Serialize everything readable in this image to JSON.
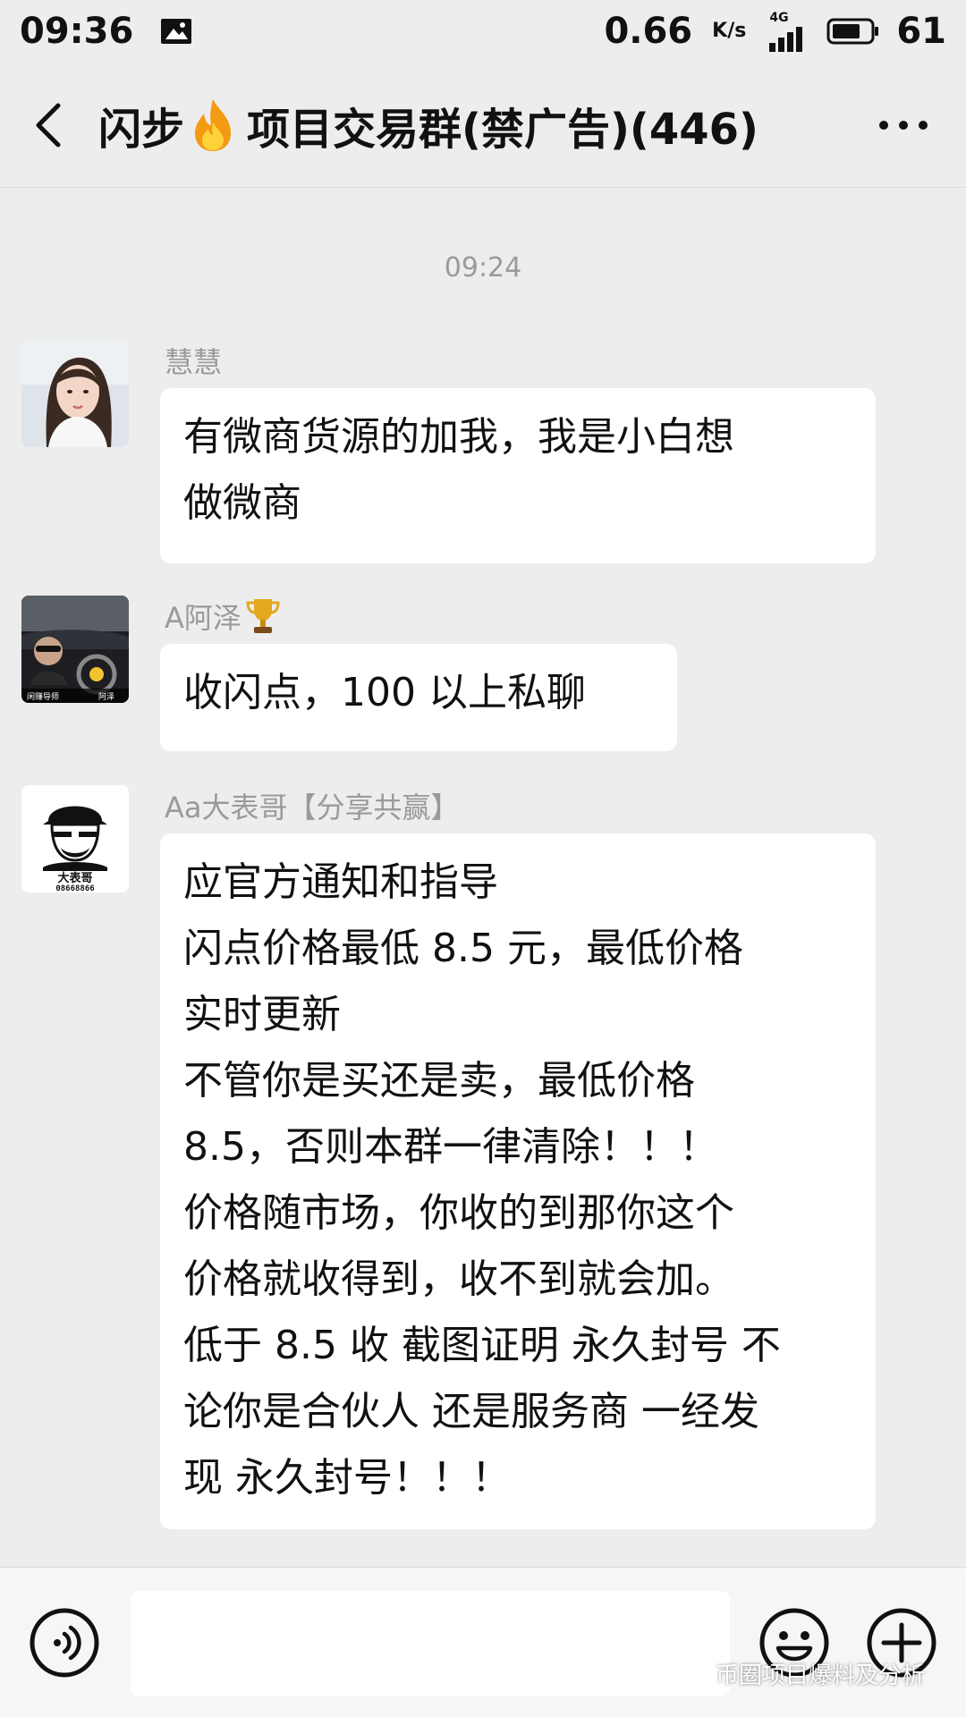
{
  "status_bar": {
    "time": "09:36",
    "net_speed": "0.66",
    "net_unit": "K/s",
    "network_type": "4G",
    "battery": "61"
  },
  "header": {
    "title_prefix": "闪步",
    "title_main": "项目交易群(禁广告)(446)"
  },
  "chat": {
    "timestamp": "09:24",
    "messages": [
      {
        "sender": "慧慧",
        "lines": [
          "有微商货源的加我，我是小白想",
          "做微商"
        ]
      },
      {
        "sender": "A阿泽",
        "lines": [
          "收闪点，100 以上私聊"
        ],
        "avatar_caption_left": "闲赚导师",
        "avatar_caption_right": "阿泽"
      },
      {
        "sender": "Aa大表哥【分享共赢】",
        "lines": [
          "应官方通知和指导",
          "闪点价格最低 8.5 元，最低价格",
          "实时更新",
          "不管你是买还是卖，最低价格",
          "8.5，否则本群一律清除！！！",
          "价格随市场，你收的到那你这个",
          "价格就收得到，收不到就会加。",
          "低于 8.5 收 截图证明 永久封号 不",
          "论你是合伙人 还是服务商 一经发",
          "现 永久封号！！！"
        ],
        "avatar_title": "大表哥",
        "avatar_number": "08668866"
      }
    ]
  },
  "watermark": "币圈项目爆料及分析",
  "colors": {
    "background": "#ededed",
    "bubble": "#ffffff",
    "text": "#111111",
    "meta_text": "#9a9a9a"
  }
}
